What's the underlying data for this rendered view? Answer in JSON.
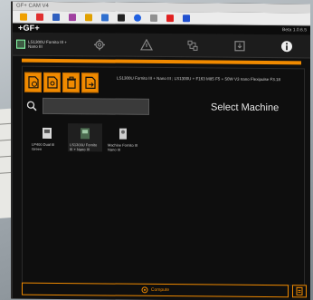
{
  "window": {
    "title": "GF+ CAM V4"
  },
  "header": {
    "brand": "+GF+",
    "version": "Beta 1.0.6.5"
  },
  "nav": {
    "machine_label": "LS1300U Fornito III + Nano III"
  },
  "info": {
    "text": "LS1300U Fornito III + Nano III ; LS1300U + F163 M85 F5 + 50W V3 nano Flexipulse F3.18"
  },
  "search": {
    "value": "",
    "placeholder": ""
  },
  "select_title": "Select Machine",
  "machines": [
    {
      "label": "LP400 Dual III Green"
    },
    {
      "label": "LS1300U Fornito III + Nano III"
    },
    {
      "label": "Machine Fornito III Nano III"
    }
  ],
  "compute": {
    "label": "Compute"
  },
  "colors": {
    "accent": "#f08a00",
    "background": "#0e0e0e"
  },
  "icons": [
    "settings-gear-icon",
    "warning-icon",
    "network-icon",
    "export-icon",
    "info-icon",
    "search-icon",
    "compute-icon"
  ]
}
